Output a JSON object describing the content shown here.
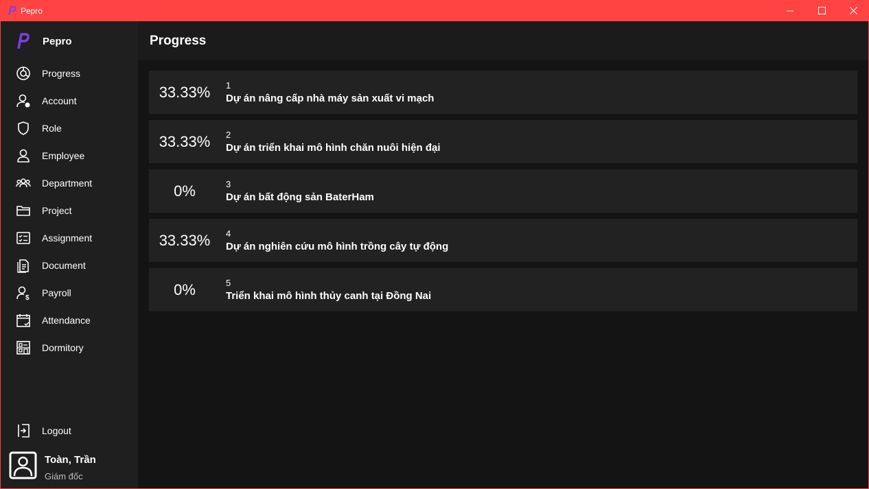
{
  "window": {
    "title": "Pepro"
  },
  "sidebar": {
    "brand": "Pepro",
    "items": [
      {
        "label": "Progress",
        "icon": "progress-icon"
      },
      {
        "label": "Account",
        "icon": "account-icon"
      },
      {
        "label": "Role",
        "icon": "shield-icon"
      },
      {
        "label": "Employee",
        "icon": "person-icon"
      },
      {
        "label": "Department",
        "icon": "people-group-icon"
      },
      {
        "label": "Project",
        "icon": "folder-icon"
      },
      {
        "label": "Assignment",
        "icon": "checklist-icon"
      },
      {
        "label": "Document",
        "icon": "document-icon"
      },
      {
        "label": "Payroll",
        "icon": "payroll-icon"
      },
      {
        "label": "Attendance",
        "icon": "calendar-check-icon"
      },
      {
        "label": "Dormitory",
        "icon": "dormitory-icon"
      }
    ],
    "logout": "Logout",
    "user": {
      "name": "Toàn, Trần",
      "role": "Giám đốc"
    }
  },
  "page": {
    "title": "Progress"
  },
  "projects": [
    {
      "percent": "33.33%",
      "id": "1",
      "name": "Dự án nâng cấp nhà máy sản xuất vi mạch"
    },
    {
      "percent": "33.33%",
      "id": "2",
      "name": "Dự án triển khai mô hình chăn nuôi hiện đại"
    },
    {
      "percent": "0%",
      "id": "3",
      "name": "Dự án bất động sản BaterHam"
    },
    {
      "percent": "33.33%",
      "id": "4",
      "name": "Dự án nghiên cứu mô hình trồng cây tự động"
    },
    {
      "percent": "0%",
      "id": "5",
      "name": "Triển khai mô hình thủy canh tại Đồng Nai"
    }
  ],
  "colors": {
    "titlebar": "#ff4343",
    "brand": "#7b3fe4"
  }
}
